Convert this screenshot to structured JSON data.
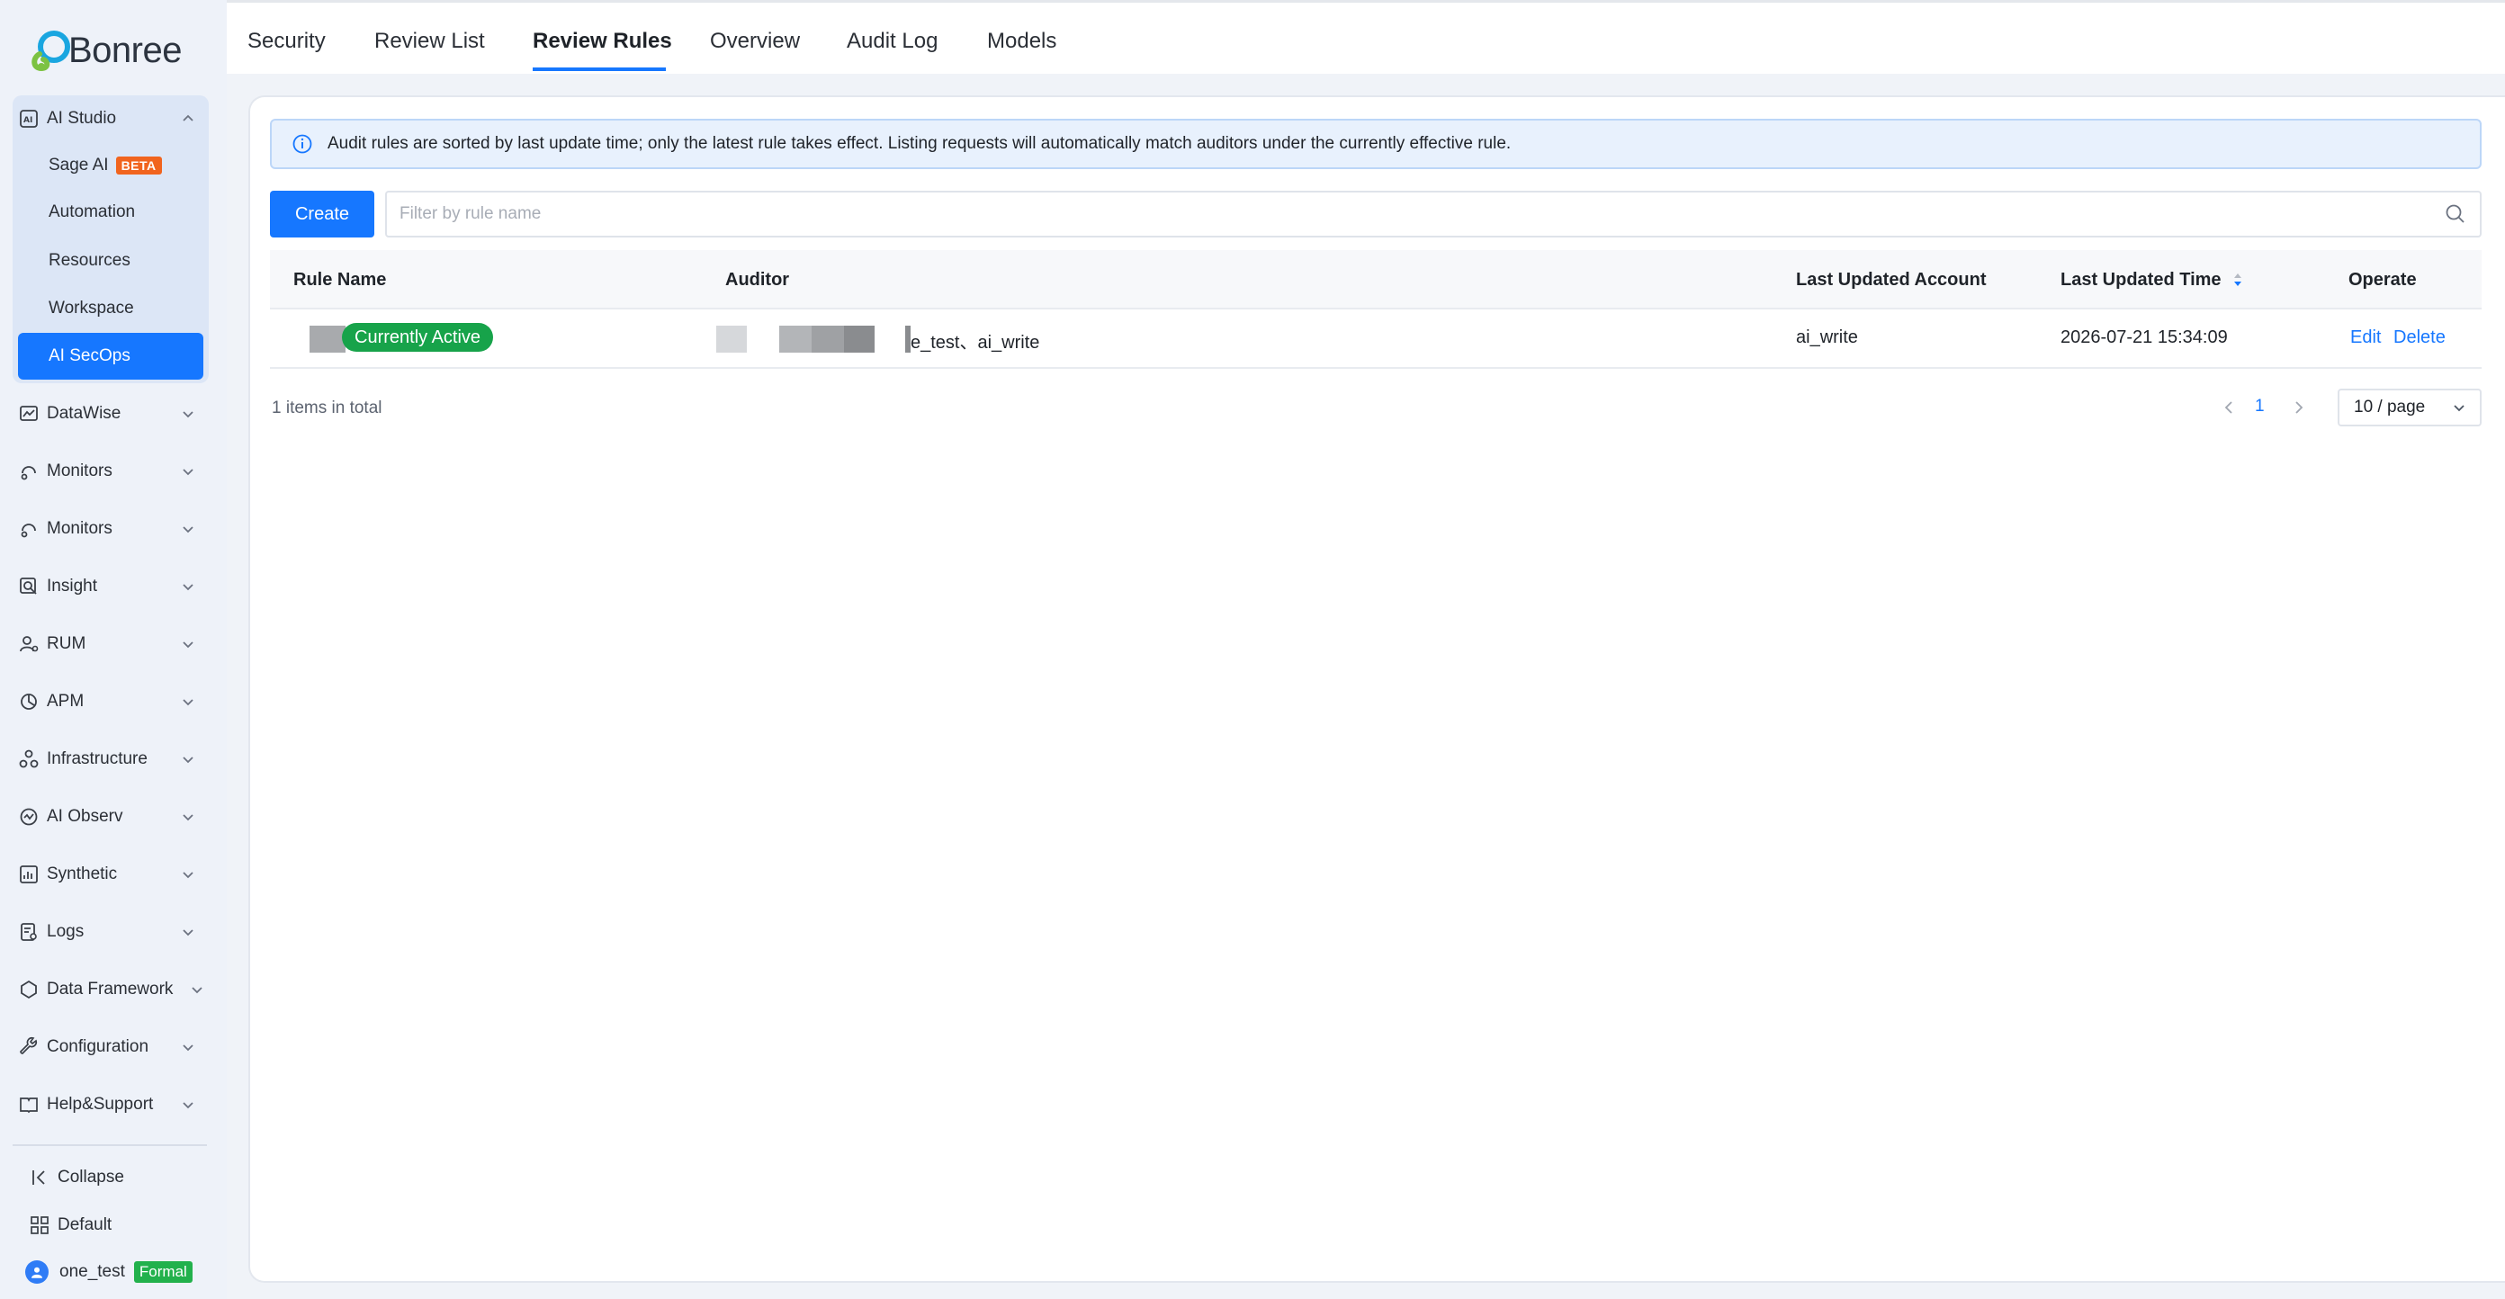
{
  "brand": {
    "name": "Bonree",
    "colors": {
      "accent": "#1677ff",
      "sidebar_bg": "#eef2f9",
      "active_badge": "#17a34a",
      "beta": "#f1641e",
      "formal": "#22b14c"
    }
  },
  "sidebar": {
    "studio": {
      "label": "AI Studio",
      "icon": "ai-studio-icon",
      "children": [
        {
          "label": "Sage AI",
          "badge": "BETA"
        },
        {
          "label": "Automation"
        },
        {
          "label": "Resources"
        },
        {
          "label": "Workspace"
        },
        {
          "label": "AI SecOps",
          "active": true
        }
      ]
    },
    "items": [
      {
        "label": "DataWise",
        "icon": "datawise-icon"
      },
      {
        "label": "Monitors",
        "icon": "monitors-icon"
      },
      {
        "label": "Monitors",
        "icon": "monitors-icon"
      },
      {
        "label": "Insight",
        "icon": "insight-icon"
      },
      {
        "label": "RUM",
        "icon": "rum-icon"
      },
      {
        "label": "APM",
        "icon": "apm-icon"
      },
      {
        "label": "Infrastructure",
        "icon": "infrastructure-icon"
      },
      {
        "label": "AI Observ",
        "icon": "ai-observ-icon"
      },
      {
        "label": "Synthetic",
        "icon": "synthetic-icon"
      },
      {
        "label": "Logs",
        "icon": "logs-icon"
      },
      {
        "label": "Data Framework",
        "icon": "data-framework-icon"
      },
      {
        "label": "Configuration",
        "icon": "configuration-icon"
      },
      {
        "label": "Help&Support",
        "icon": "help-support-icon"
      }
    ],
    "footer": {
      "collapse": "Collapse",
      "default": "Default",
      "user": "one_test",
      "user_badge": "Formal"
    }
  },
  "tabs": [
    {
      "label": "Security"
    },
    {
      "label": "Review List"
    },
    {
      "label": "Review Rules",
      "active": true
    },
    {
      "label": "Overview"
    },
    {
      "label": "Audit Log"
    },
    {
      "label": "Models"
    }
  ],
  "alert": {
    "text": "Audit rules are sorted by last update time; only the latest rule takes effect. Listing requests will automatically match auditors under the currently effective rule."
  },
  "toolbar": {
    "create_label": "Create",
    "search_placeholder": "Filter by rule name"
  },
  "table": {
    "columns": [
      "Rule Name",
      "Auditor",
      "Last Updated Account",
      "Last Updated Time",
      "Operate"
    ],
    "rows": [
      {
        "status_badge": "Currently Active",
        "auditor_visible": "e_test、ai_write",
        "last_updated_account": "ai_write",
        "last_updated_time": "2026-07-21 15:34:09",
        "actions": [
          "Edit",
          "Delete"
        ]
      }
    ]
  },
  "pagination": {
    "total_text": "1 items in total",
    "current_page": "1",
    "page_size": "10 / page"
  }
}
